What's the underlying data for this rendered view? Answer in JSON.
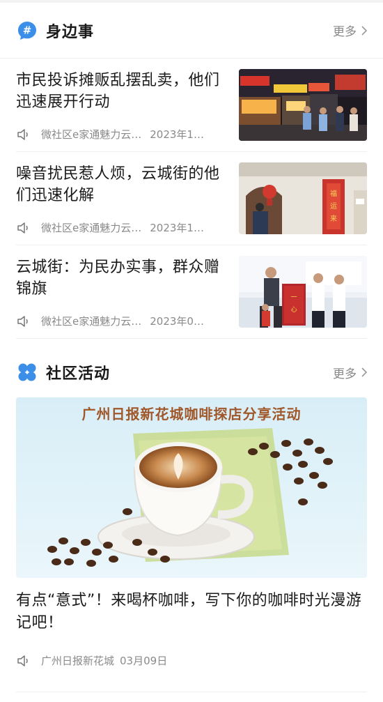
{
  "nearby": {
    "title": "身边事",
    "icon": "hashtag-bubble-icon",
    "more_label": "更多",
    "items": [
      {
        "title": "市民投诉摊贩乱摆乱卖，他们迅速展开行动",
        "source": "微社区e家通魅力云…",
        "date": "2023年1…",
        "thumb": "night-market-street-photo"
      },
      {
        "title": "噪音扰民惹人烦，云城街的他们迅速化解",
        "source": "微社区e家通魅力云…",
        "date": "2023年1…",
        "thumb": "officer-at-door-photo"
      },
      {
        "title": "云城街：为民办实事，群众赠锦旗",
        "source": "微社区e家通魅力云…",
        "date": "2023年0…",
        "thumb": "banner-presentation-photo"
      }
    ]
  },
  "activities": {
    "title": "社区活动",
    "icon": "four-petal-icon",
    "more_label": "更多",
    "banner_text": "广州日报新花城咖啡探店分享活动",
    "item": {
      "title": "有点“意式”！来喝杯咖啡，写下你的咖啡时光漫游记吧！",
      "source": "广州日报新花城",
      "date": "03月09日"
    }
  },
  "colors": {
    "accent_blue": "#3b8fe8",
    "title_text": "#1a1a1a",
    "meta_text": "#8a8a8a",
    "banner_title": "#a0572a"
  }
}
